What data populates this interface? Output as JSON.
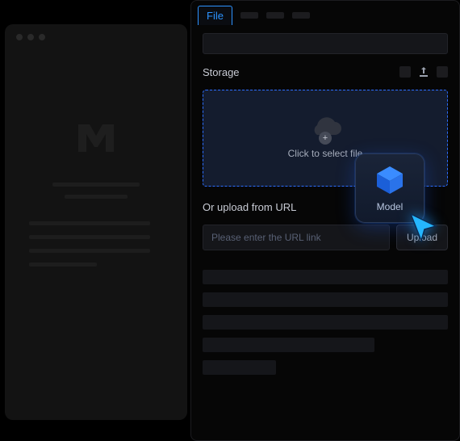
{
  "tabs": {
    "active": "File",
    "stubs": 3
  },
  "storage": {
    "title": "Storage",
    "dropzone_text": "Click to select file"
  },
  "url_section": {
    "label": "Or upload from URL",
    "placeholder": "Please enter the URL link",
    "value": "",
    "button": "Upload"
  },
  "chip": {
    "label": "Model"
  },
  "icons": {
    "upload": "upload-icon",
    "plus": "plus-icon",
    "cloud": "cloud-icon",
    "cube": "cube-icon",
    "cursor": "cursor-icon"
  },
  "colors": {
    "accent": "#2c93ff",
    "dropzone_border": "#2c6dff",
    "dropzone_bg": "#141c2e"
  }
}
